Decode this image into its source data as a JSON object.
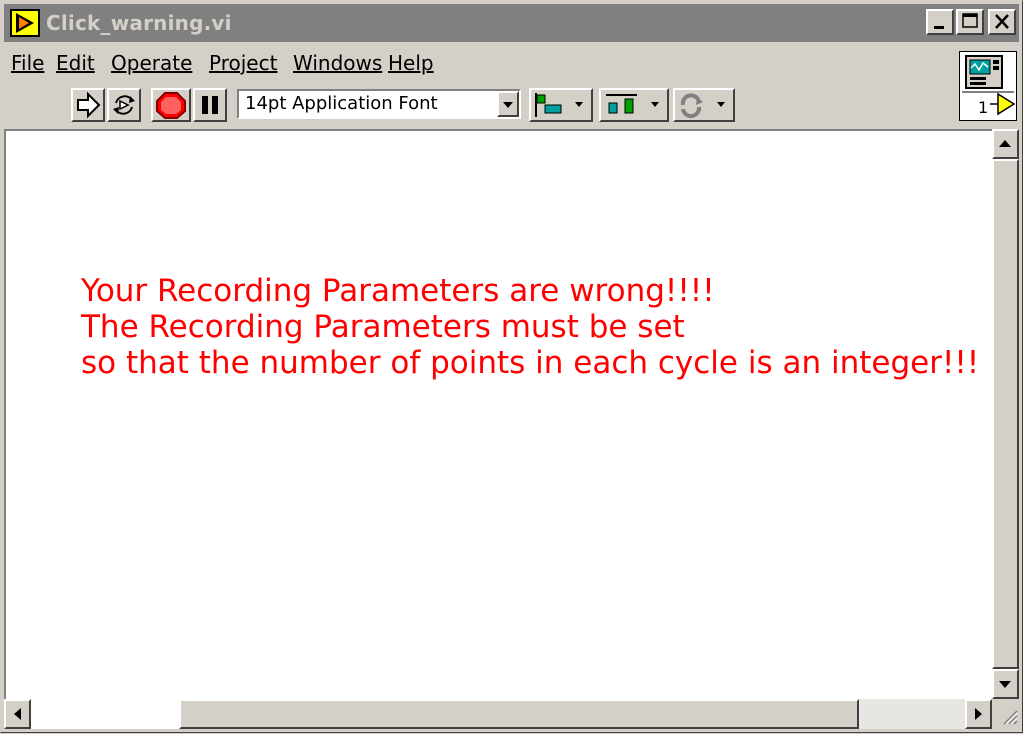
{
  "window": {
    "title": "Click_warning.vi"
  },
  "menu": {
    "items": [
      {
        "label": "File"
      },
      {
        "label": "Edit"
      },
      {
        "label": "Operate"
      },
      {
        "label": "Project"
      },
      {
        "label": "Windows"
      },
      {
        "label": "Help"
      }
    ]
  },
  "toolbar": {
    "font_value": "14pt Application Font",
    "buttons": [
      "run-arrow-icon",
      "run-continuously-icon",
      "abort-icon",
      "pause-icon",
      "align-objects-icon",
      "distribute-objects-icon",
      "reorder-icon"
    ]
  },
  "connector_pane": {
    "number": "1"
  },
  "content": {
    "lines": [
      "Your Recording Parameters are wrong!!!!",
      "The Recording Parameters must be set",
      "so that the number of points in each cycle is an integer!!!"
    ],
    "message_color": "#ff0000"
  },
  "colors": {
    "title_bar_inactive": "#808080",
    "chrome": "#d4d0c8",
    "canvas": "#ffffff"
  }
}
